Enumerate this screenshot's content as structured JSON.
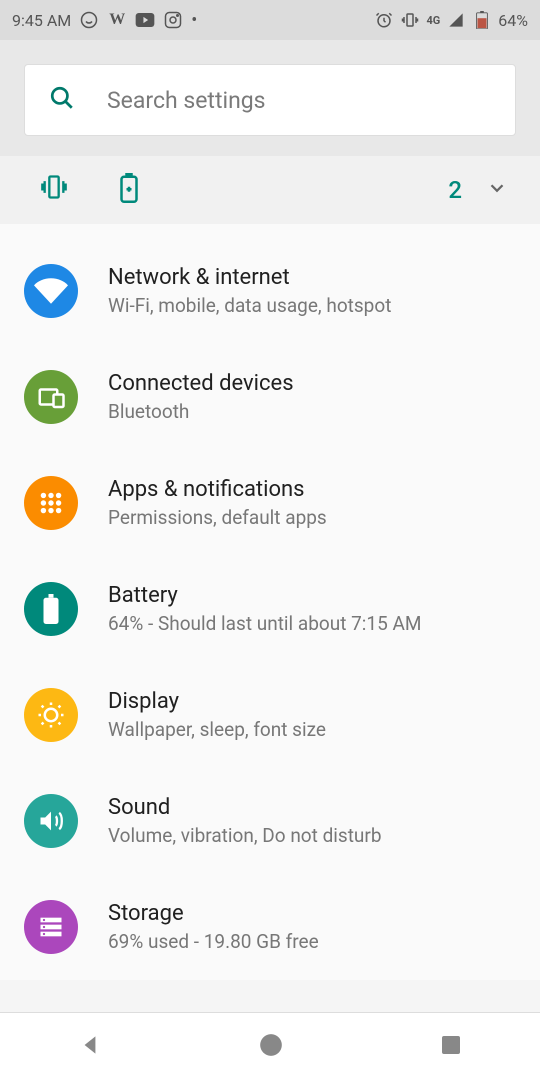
{
  "status": {
    "time": "9:45 AM",
    "network_label": "4G",
    "battery_pct": "64%"
  },
  "search": {
    "placeholder": "Search settings"
  },
  "suggestions": {
    "count": "2"
  },
  "settings": [
    {
      "title": "Network & internet",
      "subtitle": "Wi-Fi, mobile, data usage, hotspot",
      "color": "#1e88e5",
      "icon": "wifi"
    },
    {
      "title": "Connected devices",
      "subtitle": "Bluetooth",
      "color": "#689f38",
      "icon": "devices"
    },
    {
      "title": "Apps & notifications",
      "subtitle": "Permissions, default apps",
      "color": "#fb8c00",
      "icon": "apps"
    },
    {
      "title": "Battery",
      "subtitle": "64% - Should last until about 7:15 AM",
      "color": "#00897b",
      "icon": "battery"
    },
    {
      "title": "Display",
      "subtitle": "Wallpaper, sleep, font size",
      "color": "#fdb813",
      "icon": "display"
    },
    {
      "title": "Sound",
      "subtitle": "Volume, vibration, Do not disturb",
      "color": "#26a69a",
      "icon": "sound"
    },
    {
      "title": "Storage",
      "subtitle": "69% used - 19.80 GB free",
      "color": "#ab47bc",
      "icon": "storage"
    }
  ]
}
